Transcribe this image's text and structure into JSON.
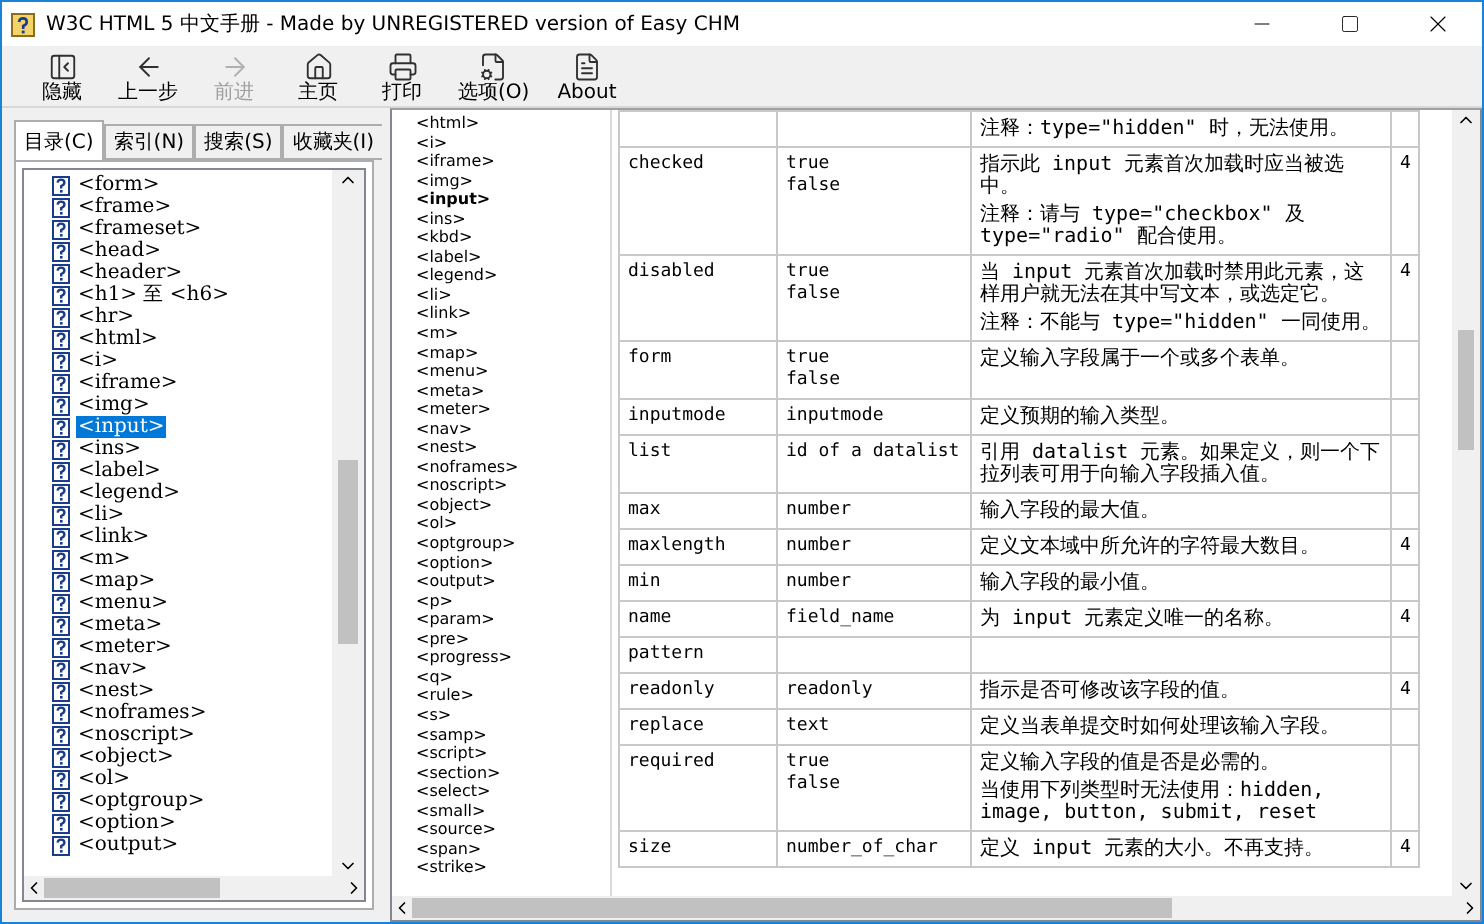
{
  "window": {
    "title": "W3C HTML 5 中文手册 - Made by UNREGISTERED version of Easy CHM"
  },
  "toolbar": [
    {
      "kind": "hide",
      "label": "隐藏",
      "disabled": false
    },
    {
      "kind": "back",
      "label": "上一步",
      "disabled": false
    },
    {
      "kind": "forward",
      "label": "前进",
      "disabled": true
    },
    {
      "kind": "home",
      "label": "主页",
      "disabled": false
    },
    {
      "kind": "print",
      "label": "打印",
      "disabled": false
    },
    {
      "kind": "options",
      "label": "选项(O)",
      "disabled": false
    },
    {
      "kind": "about",
      "label": "About",
      "disabled": false
    }
  ],
  "nav_tabs": [
    {
      "label": "目录(C)",
      "selected": true
    },
    {
      "label": "索引(N)",
      "selected": false
    },
    {
      "label": "搜索(S)",
      "selected": false
    },
    {
      "label": "收藏夹(I)",
      "selected": false
    }
  ],
  "contents_tree": [
    {
      "label": "<form>",
      "selected": false
    },
    {
      "label": "<frame>",
      "selected": false
    },
    {
      "label": "<frameset>",
      "selected": false
    },
    {
      "label": "<head>",
      "selected": false
    },
    {
      "label": "<header>",
      "selected": false
    },
    {
      "label": "<h1> 至 <h6>",
      "selected": false
    },
    {
      "label": "<hr>",
      "selected": false
    },
    {
      "label": "<html>",
      "selected": false
    },
    {
      "label": "<i>",
      "selected": false
    },
    {
      "label": "<iframe>",
      "selected": false
    },
    {
      "label": "<img>",
      "selected": false
    },
    {
      "label": "<input>",
      "selected": true
    },
    {
      "label": "<ins>",
      "selected": false
    },
    {
      "label": "<label>",
      "selected": false
    },
    {
      "label": "<legend>",
      "selected": false
    },
    {
      "label": "<li>",
      "selected": false
    },
    {
      "label": "<link>",
      "selected": false
    },
    {
      "label": "<m>",
      "selected": false
    },
    {
      "label": "<map>",
      "selected": false
    },
    {
      "label": "<menu>",
      "selected": false
    },
    {
      "label": "<meta>",
      "selected": false
    },
    {
      "label": "<meter>",
      "selected": false
    },
    {
      "label": "<nav>",
      "selected": false
    },
    {
      "label": "<nest>",
      "selected": false
    },
    {
      "label": "<noframes>",
      "selected": false
    },
    {
      "label": "<noscript>",
      "selected": false
    },
    {
      "label": "<object>",
      "selected": false
    },
    {
      "label": "<ol>",
      "selected": false
    },
    {
      "label": "<optgroup>",
      "selected": false
    },
    {
      "label": "<option>",
      "selected": false
    },
    {
      "label": "<output>",
      "selected": false
    }
  ],
  "element_list": [
    {
      "label": "<html>",
      "selected": false
    },
    {
      "label": "<i>",
      "selected": false
    },
    {
      "label": "<iframe>",
      "selected": false
    },
    {
      "label": "<img>",
      "selected": false
    },
    {
      "label": "<input>",
      "selected": true
    },
    {
      "label": "<ins>",
      "selected": false
    },
    {
      "label": "<kbd>",
      "selected": false
    },
    {
      "label": "<label>",
      "selected": false
    },
    {
      "label": "<legend>",
      "selected": false
    },
    {
      "label": "<li>",
      "selected": false
    },
    {
      "label": "<link>",
      "selected": false
    },
    {
      "label": "<m>",
      "selected": false
    },
    {
      "label": "<map>",
      "selected": false
    },
    {
      "label": "<menu>",
      "selected": false
    },
    {
      "label": "<meta>",
      "selected": false
    },
    {
      "label": "<meter>",
      "selected": false
    },
    {
      "label": "<nav>",
      "selected": false
    },
    {
      "label": "<nest>",
      "selected": false
    },
    {
      "label": "<noframes>",
      "selected": false
    },
    {
      "label": "<noscript>",
      "selected": false
    },
    {
      "label": "<object>",
      "selected": false
    },
    {
      "label": "<ol>",
      "selected": false
    },
    {
      "label": "<optgroup>",
      "selected": false
    },
    {
      "label": "<option>",
      "selected": false
    },
    {
      "label": "<output>",
      "selected": false
    },
    {
      "label": "<p>",
      "selected": false
    },
    {
      "label": "<param>",
      "selected": false
    },
    {
      "label": "<pre>",
      "selected": false
    },
    {
      "label": "<progress>",
      "selected": false
    },
    {
      "label": "<q>",
      "selected": false
    },
    {
      "label": "<rule>",
      "selected": false
    },
    {
      "label": "<s>",
      "selected": false
    },
    {
      "label": "<samp>",
      "selected": false
    },
    {
      "label": "<script>",
      "selected": false
    },
    {
      "label": "<section>",
      "selected": false
    },
    {
      "label": "<select>",
      "selected": false
    },
    {
      "label": "<small>",
      "selected": false
    },
    {
      "label": "<source>",
      "selected": false
    },
    {
      "label": "<span>",
      "selected": false
    },
    {
      "label": "<strike>",
      "selected": false
    }
  ],
  "attribute_table": {
    "rows": [
      {
        "description": [
          "注释：type=\"hidden\" 时，无法使用。"
        ]
      },
      {
        "attribute": "checked",
        "values": [
          "true",
          "false"
        ],
        "description": [
          "指示此 input 元素首次加载时应当被选中。",
          "注释：请与 type=\"checkbox\" 及 type=\"radio\" 配合使用。"
        ],
        "version": "4"
      },
      {
        "attribute": "disabled",
        "values": [
          "true",
          "false"
        ],
        "description": [
          "当 input 元素首次加载时禁用此元素，这样用户就无法在其中写文本，或选定它。",
          "注释：不能与 type=\"hidden\" 一同使用。"
        ],
        "version": "4"
      },
      {
        "attribute": "form",
        "values": [
          "true",
          "false"
        ],
        "description": [
          "定义输入字段属于一个或多个表单。"
        ]
      },
      {
        "attribute": "inputmode",
        "values": [
          "inputmode"
        ],
        "description": [
          "定义预期的输入类型。"
        ]
      },
      {
        "attribute": "list",
        "values": [
          "id of a datalist"
        ],
        "description": [
          "引用 datalist 元素。如果定义，则一个下拉列表可用于向输入字段插入值。"
        ]
      },
      {
        "attribute": "max",
        "values": [
          "number"
        ],
        "description": [
          "输入字段的最大值。"
        ]
      },
      {
        "attribute": "maxlength",
        "values": [
          "number"
        ],
        "description": [
          "定义文本域中所允许的字符最大数目。"
        ],
        "version": "4"
      },
      {
        "attribute": "min",
        "values": [
          "number"
        ],
        "description": [
          "输入字段的最小值。"
        ]
      },
      {
        "attribute": "name",
        "values": [
          "field_name"
        ],
        "description": [
          "为 input 元素定义唯一的名称。"
        ],
        "version": "4"
      },
      {
        "attribute": "pattern"
      },
      {
        "attribute": "readonly",
        "values": [
          "readonly"
        ],
        "description": [
          "指示是否可修改该字段的值。"
        ],
        "version": "4"
      },
      {
        "attribute": "replace",
        "values": [
          "text"
        ],
        "description": [
          "定义当表单提交时如何处理该输入字段。"
        ]
      },
      {
        "attribute": "required",
        "values": [
          "true",
          "false"
        ],
        "description": [
          "定义输入字段的值是否是必需的。",
          "当使用下列类型时无法使用：hidden, image, button, submit, reset"
        ]
      },
      {
        "attribute": "size",
        "values": [
          "number_of_char"
        ],
        "description": [
          "定义 input 元素的大小。不再支持。"
        ],
        "version": "4"
      }
    ]
  }
}
